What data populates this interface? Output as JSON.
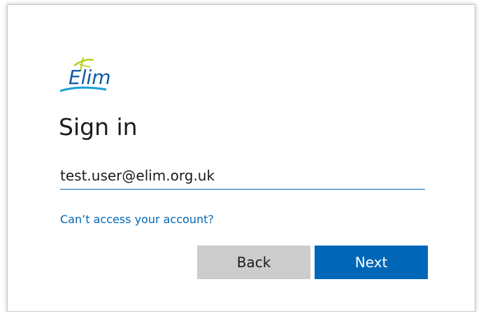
{
  "brand": {
    "logo_text": "Elim",
    "logo_icon": "elim-logo-icon",
    "text_color": "#0e5aa7",
    "swoosh_color": "#1a9fd6",
    "accent_color": "#b9cf1e"
  },
  "signin": {
    "title": "Sign in",
    "email_value": "test.user@elim.org.uk",
    "cant_access_label": "Can’t access your account?",
    "back_label": "Back",
    "next_label": "Next"
  },
  "colors": {
    "primary": "#0067b8",
    "secondary_button": "#cccccc",
    "text": "#1b1b1b"
  }
}
